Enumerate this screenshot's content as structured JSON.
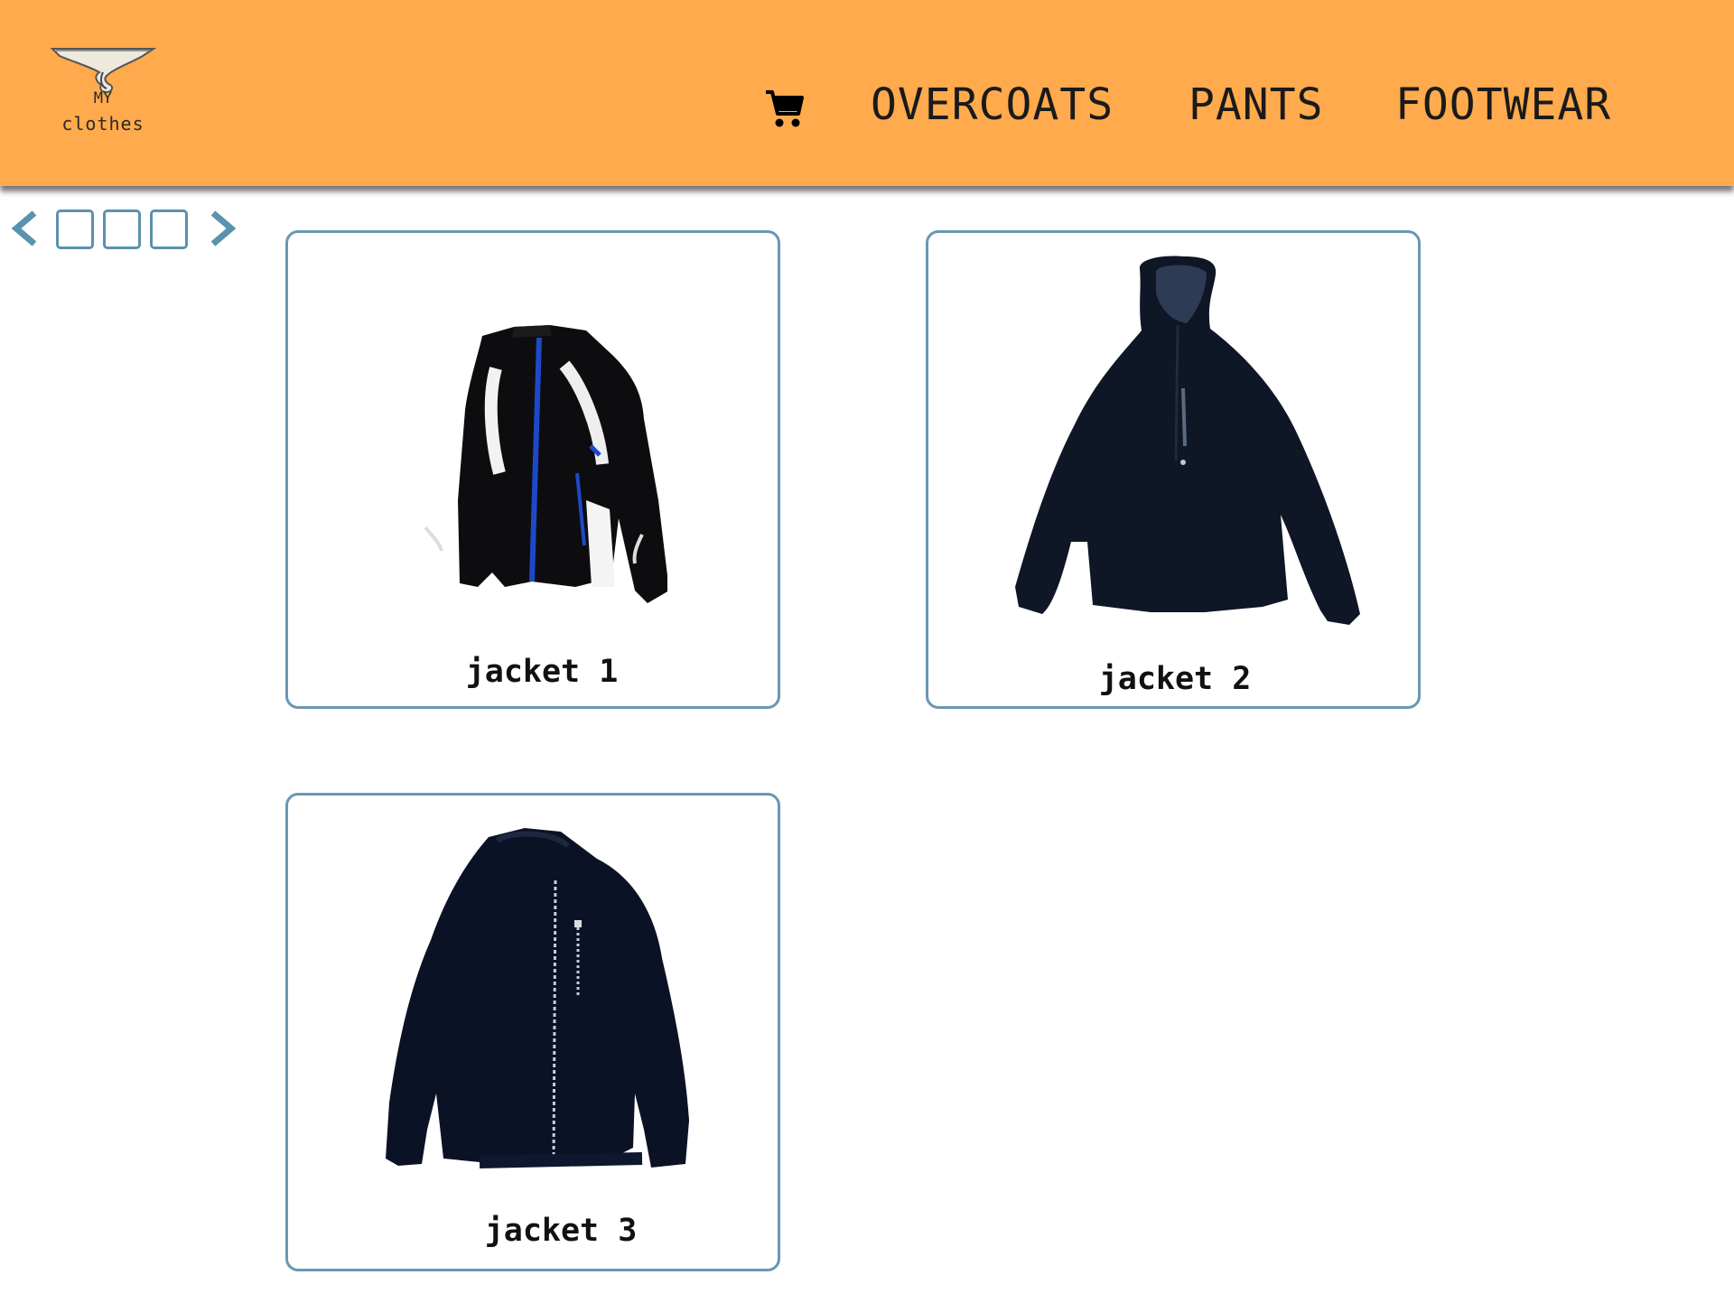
{
  "header": {
    "background_color": "#ffaa4c",
    "logo": {
      "line1": "MY",
      "line2": "clothes",
      "icon": "hanger-logo"
    },
    "cart_icon": "shopping-cart-icon",
    "nav": [
      {
        "label": "OVERCOATS"
      },
      {
        "label": "PANTS"
      },
      {
        "label": "FOOTWEAR"
      }
    ]
  },
  "pager": {
    "prev_icon": "chevron-left-icon",
    "next_icon": "chevron-right-icon",
    "page_count": 3,
    "accent_color": "#5b92ad"
  },
  "products": [
    {
      "name": "jacket 1",
      "image": "black-sport-jacket-with-blue-zip"
    },
    {
      "name": "jacket 2",
      "image": "navy-hooded-jacket"
    },
    {
      "name": "jacket 3",
      "image": "navy-bomber-jacket"
    }
  ]
}
